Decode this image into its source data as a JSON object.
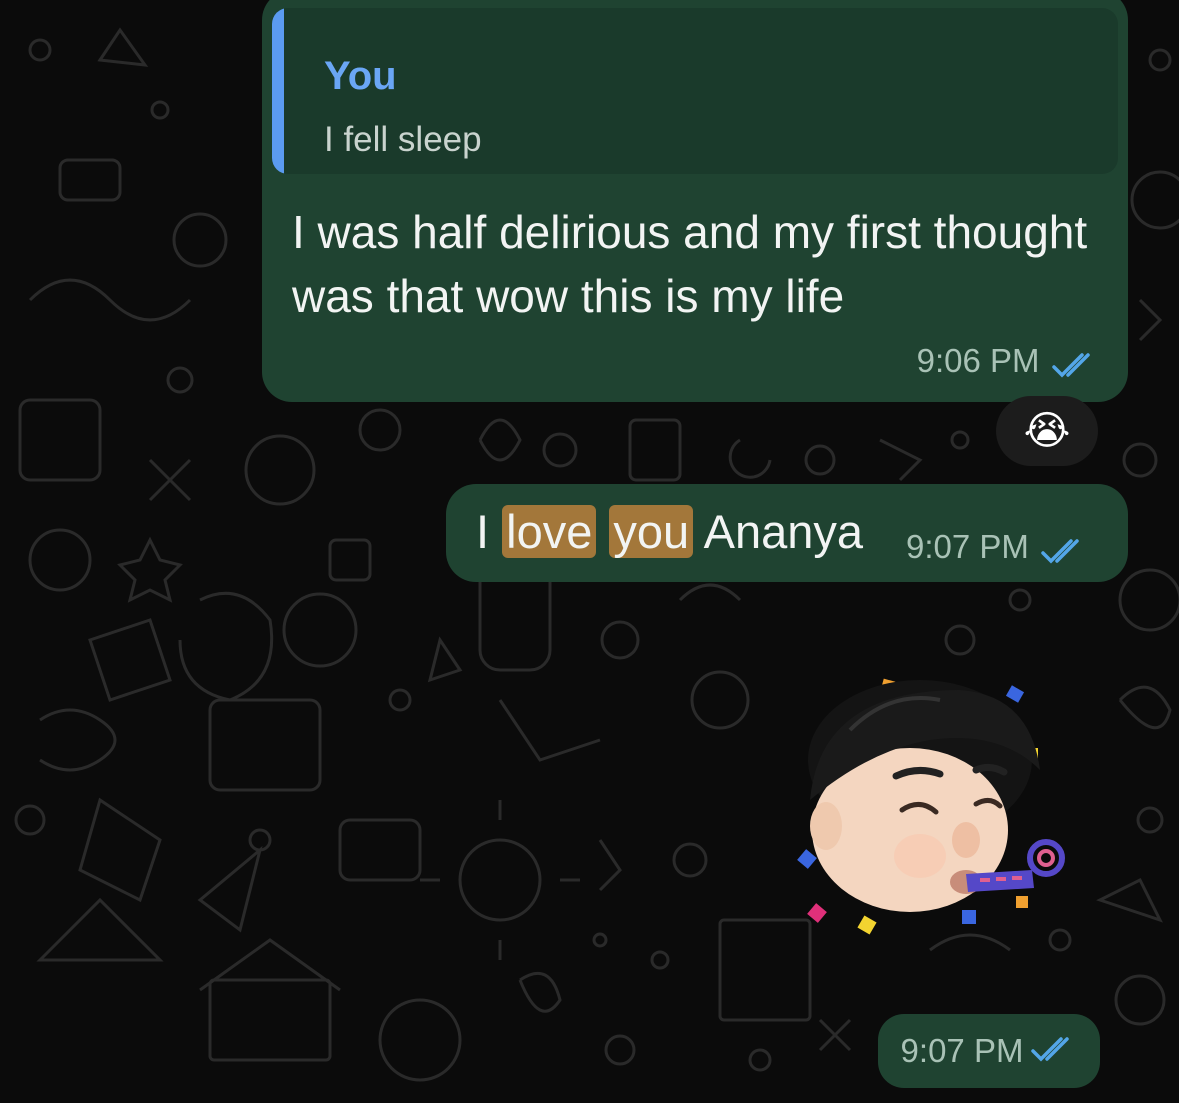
{
  "messages": [
    {
      "reply": {
        "author": "You",
        "text": "I fell sleep"
      },
      "text": "I was half delirious and my first thought was that wow this is my life",
      "time": "9:06 PM",
      "reaction": "😭"
    },
    {
      "parts": [
        "I ",
        "love",
        " ",
        "you",
        " Ananya"
      ],
      "time": "9:07 PM"
    },
    {
      "sticker": "memoji-party-icon",
      "time": "9:07 PM"
    }
  ],
  "colors": {
    "bubble": "#1f4331",
    "quote_bg": "#1a3a2b",
    "quote_bar": "#5b9bf0",
    "highlight": "#a3773a",
    "read_ticks": "#53a6e8",
    "background": "#0b0b0b"
  }
}
